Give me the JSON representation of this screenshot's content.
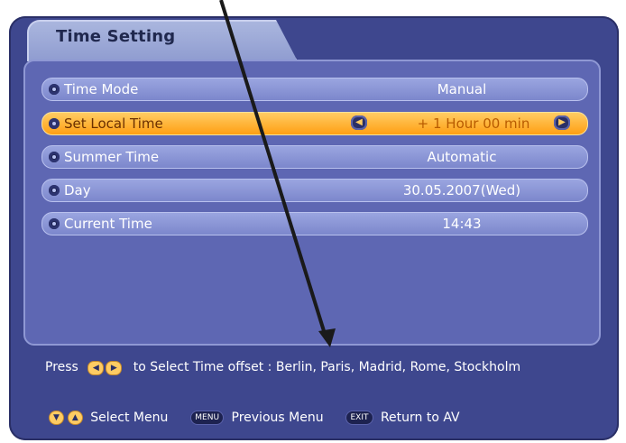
{
  "tab": {
    "title": "Time Setting"
  },
  "rows": [
    {
      "label": "Time Mode",
      "value": "Manual"
    },
    {
      "label": "Set Local Time",
      "value": "+ 1 Hour 00 min"
    },
    {
      "label": "Summer Time",
      "value": "Automatic"
    },
    {
      "label": "Day",
      "value": "30.05.2007(Wed)"
    },
    {
      "label": "Current Time",
      "value": "14:43"
    }
  ],
  "hint": {
    "prefix": "Press",
    "text": "to Select Time offset : Berlin, Paris, Madrid, Rome, Stockholm"
  },
  "footer": {
    "select": "Select Menu",
    "menu_key": "MENU",
    "previous": "Previous Menu",
    "exit_key": "EXIT",
    "return": "Return to AV"
  },
  "colors": {
    "background": "#3e478e",
    "panel": "#5e67b3",
    "selected": "#ff9f13"
  },
  "icons": {
    "row_bullet": "circle-bullet-icon",
    "left": "left-arrow-icon",
    "right": "right-arrow-icon",
    "down": "down-arrow-icon",
    "up": "up-arrow-icon",
    "callout": "annotation-arrow-icon"
  }
}
